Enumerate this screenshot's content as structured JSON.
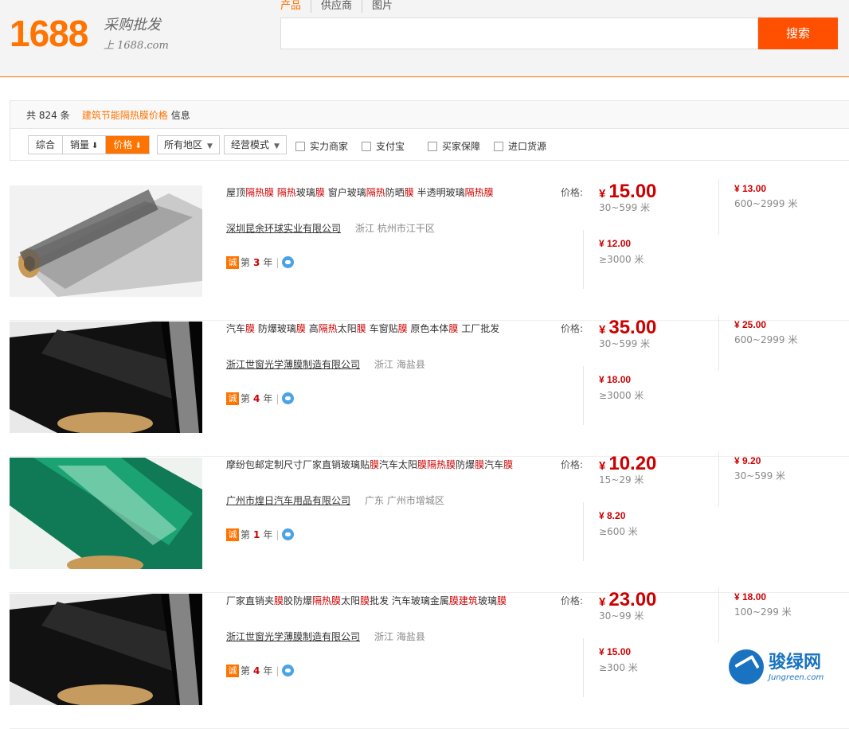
{
  "header": {
    "logo_number": "1688",
    "logo_slogan": "采购批发",
    "logo_url": "上 1688.com",
    "search_tabs": [
      "产品",
      "供应商",
      "图片"
    ],
    "search_value": "",
    "search_button": "搜索"
  },
  "summary": {
    "prefix": "共",
    "count": "824",
    "unit": "条",
    "keyword": "建筑节能隔热膜价格",
    "suffix": "信息"
  },
  "filters": {
    "sort": [
      {
        "label": "综合",
        "arrow": ""
      },
      {
        "label": "销量",
        "arrow": "⬇"
      },
      {
        "label": "价格",
        "arrow": "⬇"
      }
    ],
    "region": "所有地区",
    "mode": "经营模式",
    "checks": [
      "实力商家",
      "支付宝",
      "买家保障",
      "进口货源"
    ]
  },
  "listings": [
    {
      "title": [
        {
          "t": "屋顶",
          "h": false
        },
        {
          "t": "隔热膜",
          "h": true
        },
        {
          "t": " ",
          "h": false
        },
        {
          "t": "隔热",
          "h": true
        },
        {
          "t": "玻璃",
          "h": false
        },
        {
          "t": "膜",
          "h": true
        },
        {
          "t": " 窗户玻璃",
          "h": false
        },
        {
          "t": "隔热",
          "h": true
        },
        {
          "t": "防晒",
          "h": false
        },
        {
          "t": "膜",
          "h": true
        },
        {
          "t": " 半透明玻璃",
          "h": false
        },
        {
          "t": "隔热膜",
          "h": true
        }
      ],
      "company": "深圳昆余环球实业有限公司",
      "location": "浙江 杭州市江干区",
      "year_prefix": "第",
      "years": "3",
      "year_suffix": "年",
      "price_label": "价格:",
      "yen": "¥",
      "price": "15.00",
      "range1": "30~599 米",
      "price2": "¥ 13.00",
      "range2": "600~2999 米",
      "price3": "¥ 12.00",
      "range3": "≥3000 米",
      "film": "silver"
    },
    {
      "title": [
        {
          "t": "汽车",
          "h": false
        },
        {
          "t": "膜",
          "h": true
        },
        {
          "t": " 防爆玻璃",
          "h": false
        },
        {
          "t": "膜",
          "h": true
        },
        {
          "t": " 高",
          "h": false
        },
        {
          "t": "隔热",
          "h": true
        },
        {
          "t": "太阳",
          "h": false
        },
        {
          "t": "膜",
          "h": true
        },
        {
          "t": " 车窗贴",
          "h": false
        },
        {
          "t": "膜",
          "h": true
        },
        {
          "t": " 原色本体",
          "h": false
        },
        {
          "t": "膜",
          "h": true
        },
        {
          "t": " 工厂批发",
          "h": false
        }
      ],
      "company": "浙江世窗光学薄膜制造有限公司",
      "location": "浙江 海盐县",
      "year_prefix": "第",
      "years": "4",
      "year_suffix": "年",
      "price_label": "价格:",
      "yen": "¥",
      "price": "35.00",
      "range1": "30~599 米",
      "price2": "¥ 25.00",
      "range2": "600~2999 米",
      "price3": "¥ 18.00",
      "range3": "≥3000 米",
      "film": "black"
    },
    {
      "title": [
        {
          "t": "摩纷包邮定制尺寸厂家直销玻璃贴",
          "h": false
        },
        {
          "t": "膜",
          "h": true
        },
        {
          "t": "汽车太阳",
          "h": false
        },
        {
          "t": "膜隔热膜",
          "h": true
        },
        {
          "t": "防爆",
          "h": false
        },
        {
          "t": "膜",
          "h": true
        },
        {
          "t": "汽车",
          "h": false
        },
        {
          "t": "膜",
          "h": true
        }
      ],
      "company": "广州市煌日汽车用品有限公司",
      "location": "广东 广州市增城区",
      "year_prefix": "第",
      "years": "1",
      "year_suffix": "年",
      "price_label": "价格:",
      "yen": "¥",
      "price": "10.20",
      "range1": "15~29 米",
      "price2": "¥ 9.20",
      "range2": "30~599 米",
      "price3": "¥ 8.20",
      "range3": "≥600 米",
      "film": "green"
    },
    {
      "title": [
        {
          "t": "厂家直销夹",
          "h": false
        },
        {
          "t": "膜",
          "h": true
        },
        {
          "t": "胶防爆",
          "h": false
        },
        {
          "t": "隔热膜",
          "h": true
        },
        {
          "t": "太阳",
          "h": false
        },
        {
          "t": "膜",
          "h": true
        },
        {
          "t": "批发 汽车玻璃金属",
          "h": false
        },
        {
          "t": "膜建筑",
          "h": true
        },
        {
          "t": "玻璃",
          "h": false
        },
        {
          "t": "膜",
          "h": true
        }
      ],
      "company": "浙江世窗光学薄膜制造有限公司",
      "location": "浙江 海盐县",
      "year_prefix": "第",
      "years": "4",
      "year_suffix": "年",
      "price_label": "价格:",
      "yen": "¥",
      "price": "23.00",
      "range1": "30~99 米",
      "price2": "¥ 18.00",
      "range2": "100~299 米",
      "price3": "¥ 15.00",
      "range3": "≥300 米",
      "film": "black"
    }
  ],
  "watermark": {
    "name": "骏绿网",
    "url": "Jungreen.com"
  }
}
